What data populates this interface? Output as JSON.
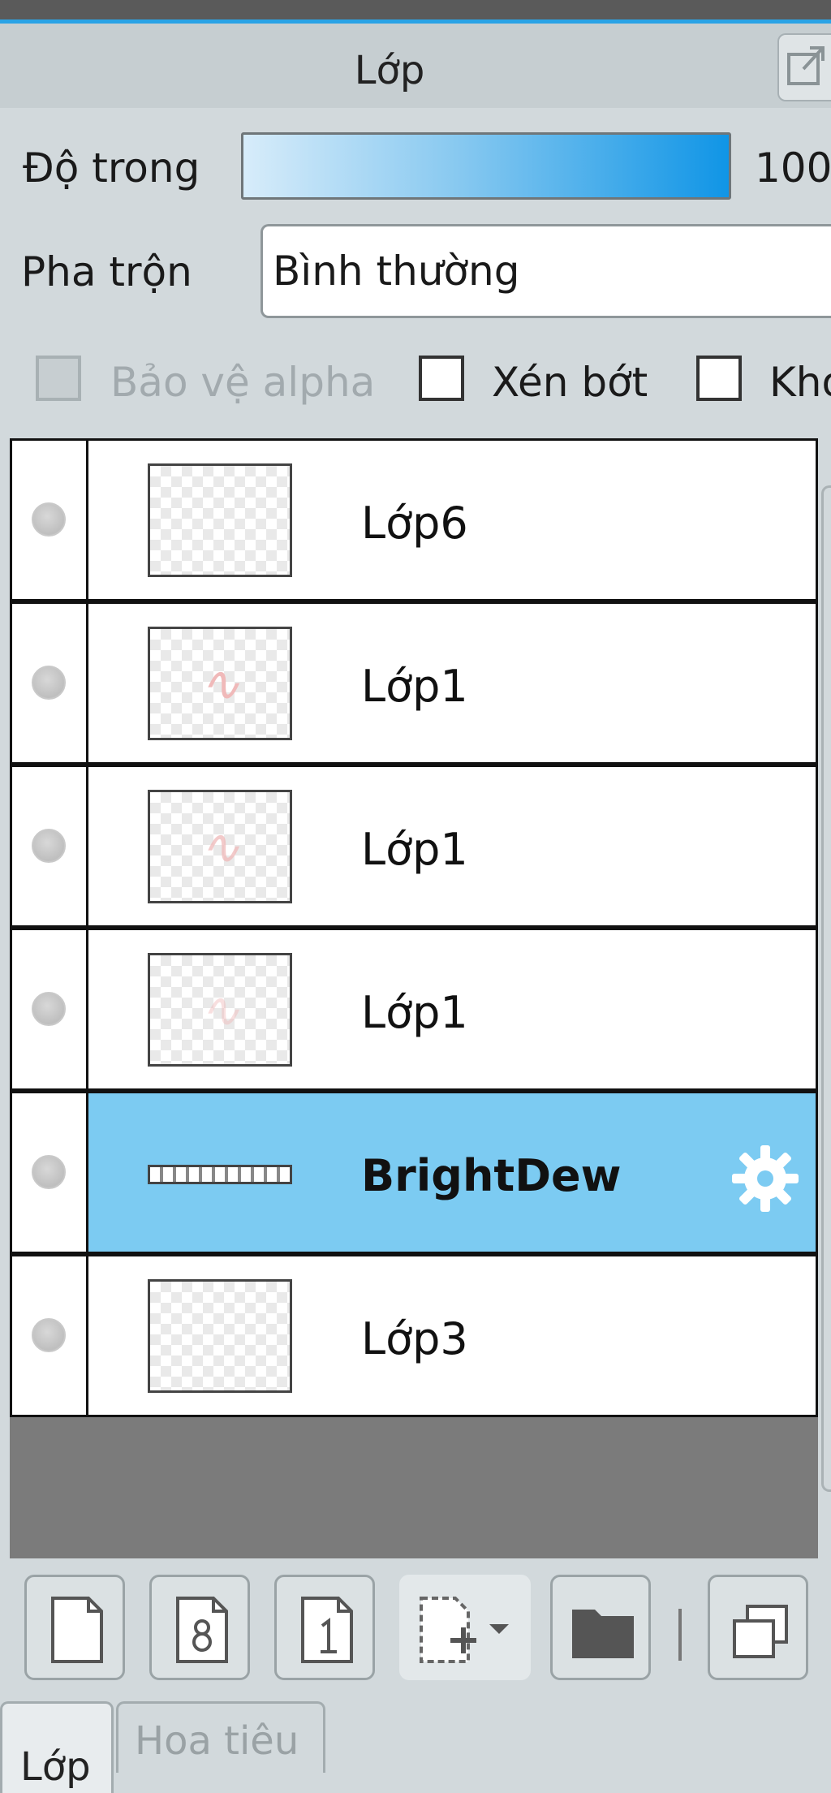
{
  "panel": {
    "title": "Lớp"
  },
  "opacity": {
    "label": "Độ trong",
    "value": "100"
  },
  "blend": {
    "label": "Pha trộn",
    "value": "Bình thường"
  },
  "checkboxes": {
    "alpha_protect": {
      "label": "Bảo vệ alpha",
      "checked": false,
      "disabled": true
    },
    "clip": {
      "label": "Xén bớt",
      "checked": false
    },
    "lock": {
      "label": "Kho",
      "checked": false
    }
  },
  "layers": [
    {
      "name": "Lớp6",
      "selected": false
    },
    {
      "name": "Lớp1",
      "selected": false
    },
    {
      "name": "Lớp1",
      "selected": false
    },
    {
      "name": "Lớp1",
      "selected": false
    },
    {
      "name": "BrightDew",
      "selected": true
    },
    {
      "name": "Lớp3",
      "selected": false
    }
  ],
  "toolbar": {
    "icons": [
      "new-layer-icon",
      "new-8bit-layer-icon",
      "new-1bit-layer-icon",
      "add-layer-dropdown-icon",
      "new-folder-icon",
      "duplicate-layer-icon"
    ]
  },
  "tabs": [
    {
      "label": "Lớp",
      "active": true
    },
    {
      "label": "Hoa tiêu",
      "active": false
    }
  ],
  "colors": {
    "accent": "#2aa3e6",
    "selected_row": "#7ccbf2",
    "panel_bg": "#d2d9dc"
  }
}
